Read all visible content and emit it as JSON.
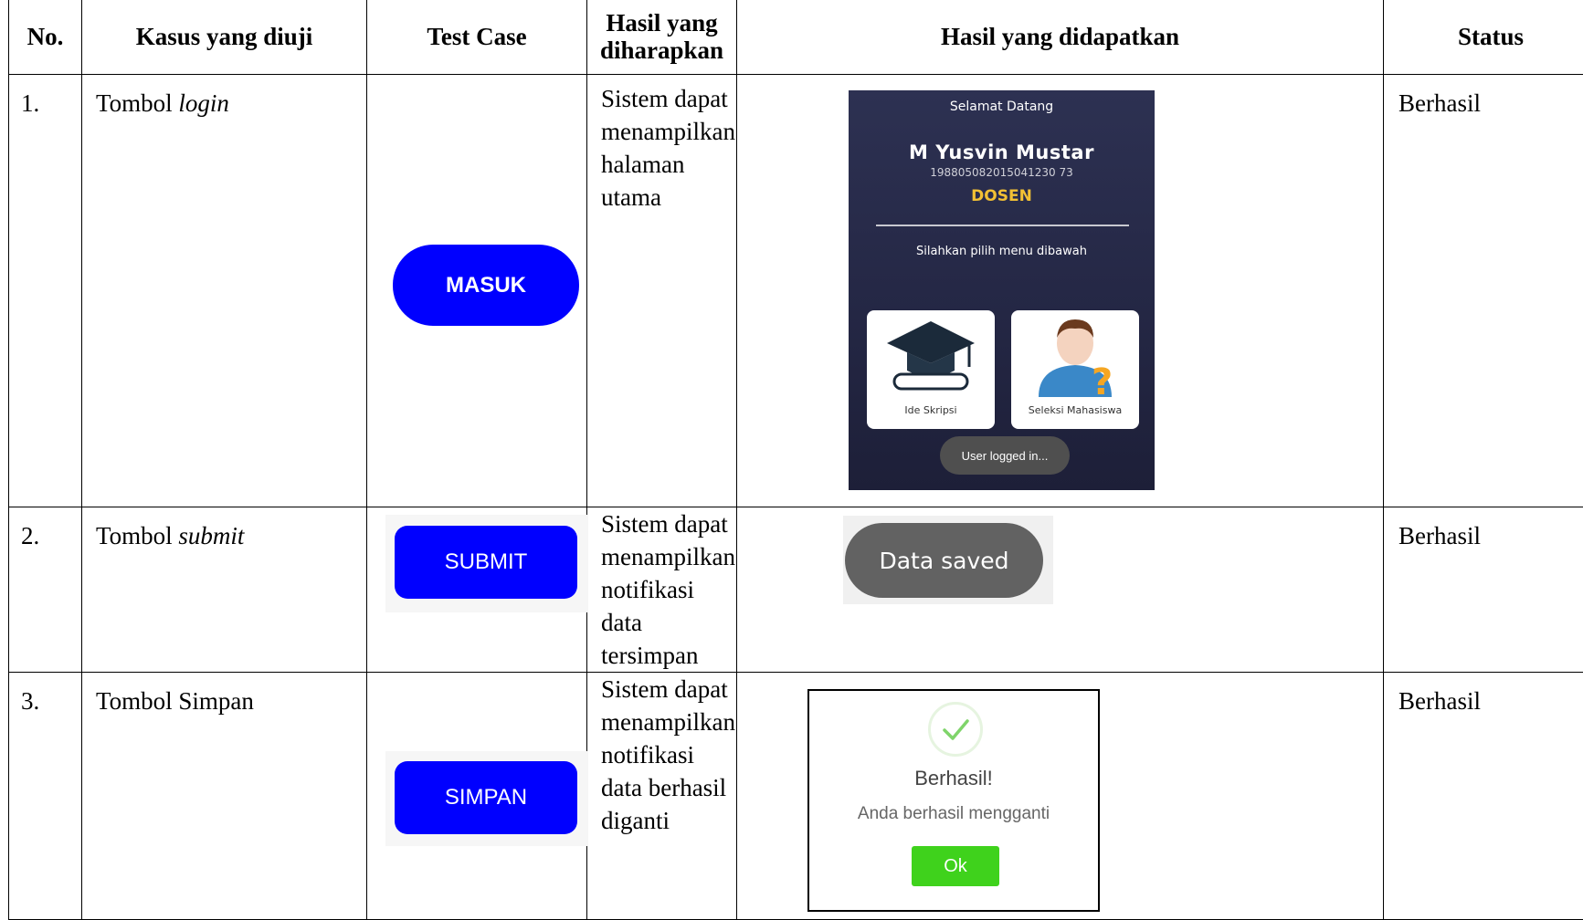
{
  "headers": {
    "no": "No.",
    "kasus": "Kasus yang diuji",
    "test_case": "Test Case",
    "hasil_diharapkan": "Hasil yang diharapkan",
    "hasil_didapatkan": "Hasil yang didapatkan",
    "status": "Status"
  },
  "rows": [
    {
      "no": "1.",
      "kasus_prefix": "Tombol",
      "kasus_italic": "login",
      "test_case_button": "MASUK",
      "expected": "Sistem dapat menampilkan halaman utama",
      "status": "Berhasil",
      "result_screen": {
        "welcome": "Selamat Datang",
        "name": "M Yusvin Mustar",
        "nip": "198805082015041230 73",
        "role": "DOSEN",
        "prompt": "Silahkan pilih menu dibawah",
        "card1": "Ide Skripsi",
        "card2": "Seleksi Mahasiswa",
        "toast": "User logged in..."
      }
    },
    {
      "no": "2.",
      "kasus_prefix": "Tombol",
      "kasus_italic": "submit",
      "test_case_button": "SUBMIT",
      "expected": "Sistem dapat menampilkan notifikasi data tersimpan",
      "status": "Berhasil",
      "result_toast": "Data saved"
    },
    {
      "no": "3.",
      "kasus_prefix": "Tombol Simpan",
      "kasus_italic": "",
      "test_case_button": "SIMPAN",
      "expected": "Sistem dapat menampilkan notifikasi data berhasil diganti",
      "status": "Berhasil",
      "result_dialog": {
        "title": "Berhasil!",
        "message": "Anda berhasil mengganti",
        "ok": "Ok"
      }
    }
  ],
  "colors": {
    "button_blue": "#0000ff",
    "role_yellow": "#f2c034",
    "ok_green": "#3fd21c"
  }
}
